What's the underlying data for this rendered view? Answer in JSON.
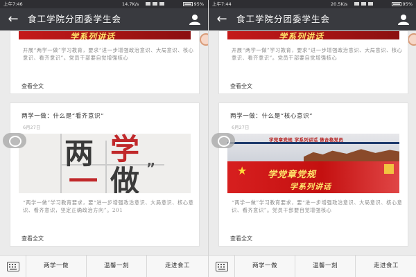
{
  "screens": [
    {
      "status": {
        "time": "上午7:46",
        "speed": "14.7K/s",
        "battery": "95%"
      },
      "header": {
        "title": "食工学院分团委学生会"
      },
      "top_card": {
        "banner_text": "学系列讲话",
        "desc": "开展“两学一做”学习教育，要求“进一步增强政治意识、大局意识、核心意识、看齐意识”。党员干部要自觉增强核心",
        "read_more": "查看全文"
      },
      "article": {
        "title": "两学一做：什么是“看齐意识”",
        "date": "6月27日",
        "image_text": {
          "c1": "两",
          "c2": "学",
          "c3": "一",
          "c4": "做",
          "quote": "”"
        },
        "desc": "“两学一做”学习教育要求，要“进一步增强政治意识、大局意识、核心意识、看齐意识，坚定正确政治方向”。201",
        "read_more": "查看全文"
      },
      "bottom_menu": [
        "两学一做",
        "温馨一刻",
        "走进食工"
      ]
    },
    {
      "status": {
        "time": "上午7:44",
        "speed": "20.5K/s",
        "battery": "95%"
      },
      "header": {
        "title": "食工学院分团委学生会"
      },
      "top_card": {
        "banner_text": "学系列讲话",
        "desc": "开展“两学一做”学习教育，要求“进一步增强政治意识、大局意识、核心意识、看齐意识”。党员干部要自觉增强核心",
        "read_more": "查看全文"
      },
      "article": {
        "title": "两学一做：什么是“核心意识”",
        "date": "6月27日",
        "image_text": {
          "header": "学党章党规 学系列讲话 做合格党员",
          "slogan": "学党章党规",
          "slogan2": "学系列讲话"
        },
        "desc": "“两学一做”学习教育要求，要“进一步增强政治意识、大局意识、核心意识、看齐意识”。党员干部要自觉增强核心",
        "read_more": "查看全文"
      },
      "bottom_menu": [
        "两学一做",
        "温馨一刻",
        "走进食工"
      ]
    }
  ]
}
